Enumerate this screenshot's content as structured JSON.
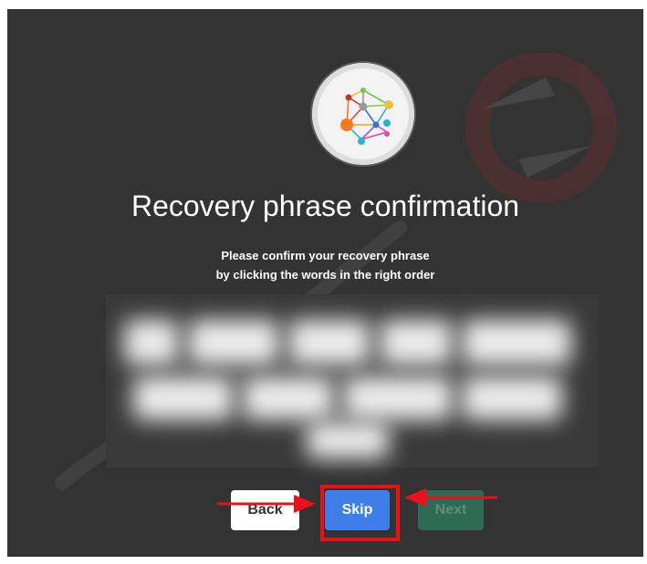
{
  "title": "Recovery phrase confirmation",
  "subtitle_line1": "Please confirm your recovery phrase",
  "subtitle_line2": "by clicking the words in the right order",
  "buttons": {
    "back": "Back",
    "skip": "Skip",
    "next": "Next"
  },
  "colors": {
    "background": "#333333",
    "skip_button": "#3f7ee8",
    "next_button_disabled": "#2f6a55",
    "highlight": "#e8121a"
  },
  "icons": {
    "logo": "network-graph-logo-icon",
    "arrow_left": "red-arrow-right-icon",
    "arrow_right": "red-arrow-left-icon"
  }
}
